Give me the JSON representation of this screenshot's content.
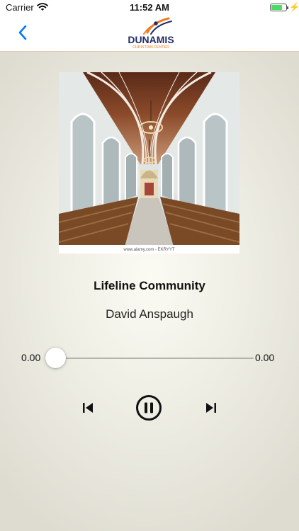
{
  "status_bar": {
    "carrier": "Carrier",
    "time": "11:52 AM",
    "battery_level": 0.85
  },
  "nav": {
    "back_icon": "chevron-left-icon",
    "logo": {
      "name": "DUNAMIS",
      "subtitle": "CHRISTIAN CENTER"
    }
  },
  "player": {
    "artwork_caption": "www.alamy.com - EKRYYT",
    "title": "Lifeline Community",
    "artist": "David Anspaugh",
    "elapsed": "0.00",
    "duration": "0.00",
    "progress": 0,
    "controls": {
      "prev": "skip-previous-icon",
      "play_pause": "pause-icon",
      "next": "skip-next-icon"
    }
  },
  "colors": {
    "accent": "#007aff",
    "logo_navy": "#232b68",
    "logo_orange": "#ef7b21",
    "divider": "#e9c2a6"
  }
}
